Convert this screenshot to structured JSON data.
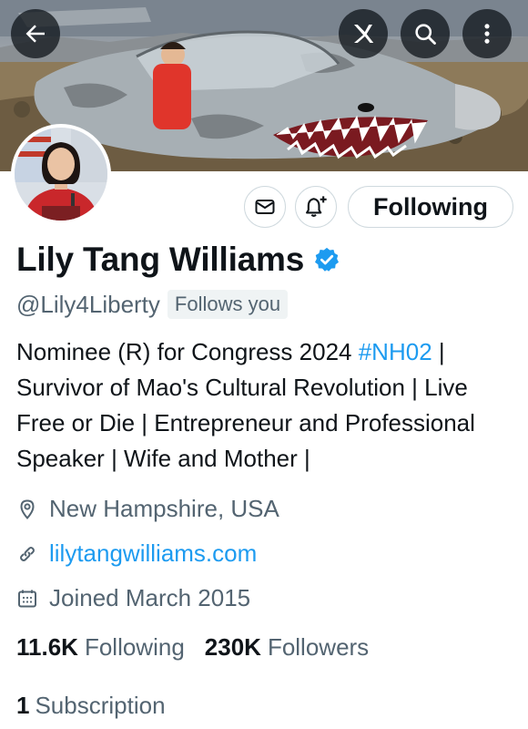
{
  "header": {
    "back_icon": "arrow-left-icon",
    "grok_icon": "grok-icon",
    "search_icon": "search-icon",
    "more_icon": "more-vertical-icon"
  },
  "actions": {
    "message_icon": "envelope-icon",
    "notify_icon": "bell-plus-icon",
    "follow_label": "Following"
  },
  "profile": {
    "name": "Lily Tang Williams",
    "verified_icon": "verified-badge-icon",
    "handle": "@Lily4Liberty",
    "follows_you": "Follows you",
    "bio_lead": "Nominee (R) for Congress 2024 ",
    "bio_hashtag": "#NH02",
    "bio_rest": " | Survivor of Mao's Cultural Revolution | Live Free or Die | Entrepreneur and Professional Speaker | Wife and Mother |",
    "location": "New Hampshire, USA",
    "website": "lilytangwilliams.com",
    "joined": "Joined March 2015"
  },
  "stats": {
    "following_count": "11.6K",
    "following_label": "Following",
    "followers_count": "230K",
    "followers_label": "Followers",
    "subscription_count": "1",
    "subscription_label": "Subscription"
  },
  "colors": {
    "link": "#1d9bf0",
    "secondary_text": "#536471",
    "primary_text": "#0f1419",
    "border": "#cfd9de"
  }
}
